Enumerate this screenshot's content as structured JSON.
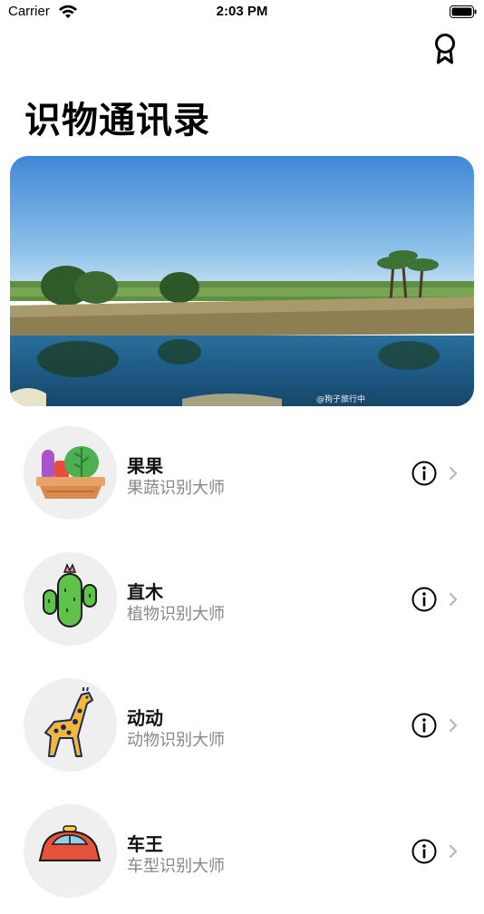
{
  "status_bar": {
    "carrier": "Carrier",
    "time": "2:03 PM"
  },
  "header": {
    "title": "识物通讯录"
  },
  "banner": {
    "watermark": "@狗子旅行中"
  },
  "items": [
    {
      "title": "果果",
      "subtitle": "果蔬识别大师",
      "icon": "vegetable-basket-icon"
    },
    {
      "title": "直木",
      "subtitle": "植物识别大师",
      "icon": "cactus-icon"
    },
    {
      "title": "动动",
      "subtitle": "动物识别大师",
      "icon": "giraffe-icon"
    },
    {
      "title": "车王",
      "subtitle": "车型识别大师",
      "icon": "car-icon"
    }
  ],
  "colors": {
    "accent": "#000000",
    "subtitle": "#888888",
    "avatar_bg": "#efefef"
  }
}
